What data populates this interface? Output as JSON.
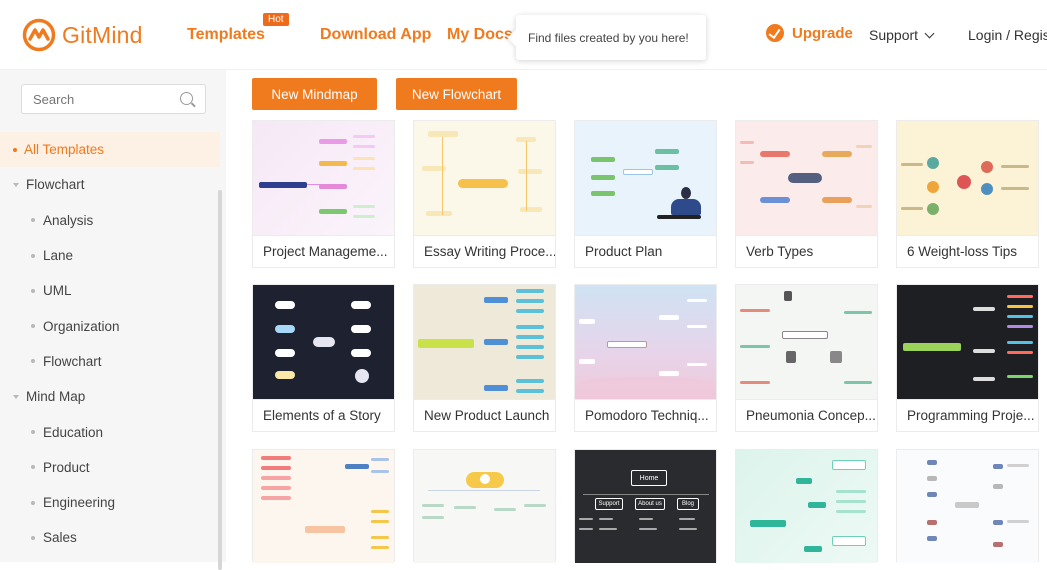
{
  "header": {
    "logo_text": "GitMind",
    "nav": {
      "templates": "Templates",
      "hot": "Hot",
      "download": "Download App",
      "mydocs": "My Docs"
    },
    "tooltip": "Find files created by you here!",
    "upgrade": "Upgrade",
    "support": "Support",
    "login": "Login / Registe"
  },
  "sidebar": {
    "search_placeholder": "Search",
    "items": [
      {
        "label": "All Templates",
        "active": true
      },
      {
        "label": "Flowchart"
      },
      {
        "label": "Analysis"
      },
      {
        "label": "Lane"
      },
      {
        "label": "UML"
      },
      {
        "label": "Organization"
      },
      {
        "label": "Flowchart"
      },
      {
        "label": "Mind Map"
      },
      {
        "label": "Education"
      },
      {
        "label": "Product"
      },
      {
        "label": "Engineering"
      },
      {
        "label": "Sales"
      }
    ]
  },
  "actions": {
    "new_mindmap": "New Mindmap",
    "new_flowchart": "New Flowchart"
  },
  "templates": {
    "row1": [
      "Project Manageme...",
      "Essay Writing Proce...",
      "Product Plan",
      "Verb Types",
      "6 Weight-loss Tips"
    ],
    "row2": [
      "Elements of a Story",
      "New Product Launch",
      "Pomodoro Techniq...",
      "Pneumonia Concep...",
      "Programming Proje..."
    ],
    "row3_thumb_text": {
      "home": "Home",
      "support": "Support",
      "about": "About us",
      "blog": "Blog"
    }
  },
  "colors": {
    "accent": "#f07a1e",
    "sidebar_bg": "#f6f6f6",
    "active_bg": "#fdf0e4"
  }
}
